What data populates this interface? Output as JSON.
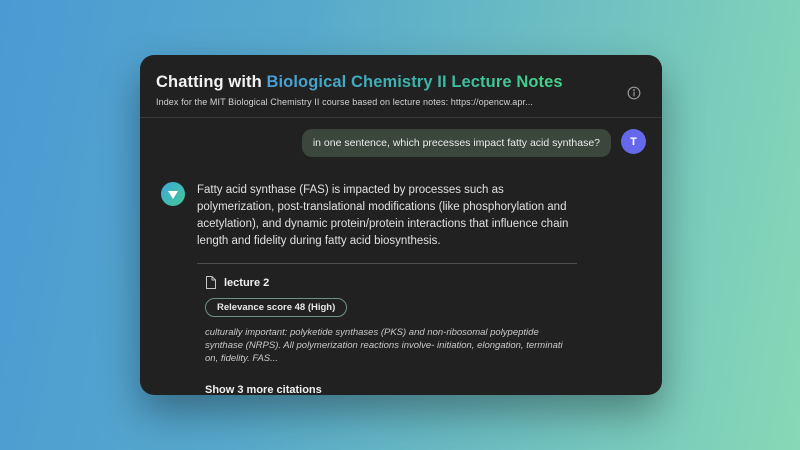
{
  "header": {
    "title_prefix": "Chatting with ",
    "title_subject": "Biological Chemistry II Lecture Notes",
    "subtitle": "Index for the MIT Biological Chemistry II course based on lecture notes: https://opencw.apr...",
    "info_icon": "info-circle-icon"
  },
  "chat": {
    "user_message": {
      "text": "in one sentence, which precesses impact fatty acid synthase?",
      "avatar_initial": "T"
    },
    "assistant_message": {
      "text": "Fatty acid synthase (FAS) is impacted by processes such as polymerization, post-translational modifications (like phosphorylation and acetylation), and dynamic protein/protein interactions that influence chain length and fidelity during fatty acid biosynthesis.",
      "avatar_icon": "triangle-down-icon"
    },
    "citation": {
      "doc_icon": "document-icon",
      "source": "lecture 2",
      "badge": "Relevance score 48 (High)",
      "excerpt": "culturally important: polyketide synthases (PKS) and non-ribosomal polypeptide synthase (NRPS). All polymerization reactions involve- initiation, elongation, terminati on, fidelity. FAS..."
    },
    "show_more_label": "Show 3 more citations"
  },
  "colors": {
    "background_gradient_start": "#4b9ad3",
    "background_gradient_end": "#87d8b6",
    "card_background": "#212121",
    "accent_blue": "#4a9edb",
    "accent_green": "#45d588",
    "user_bubble": "#3b463d",
    "user_avatar": "#6468ea"
  }
}
